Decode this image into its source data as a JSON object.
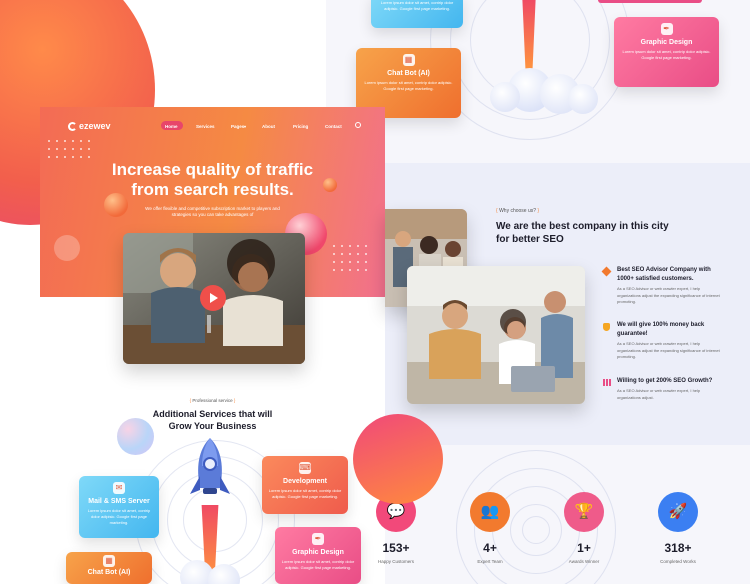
{
  "brand": {
    "logo": "ezewev"
  },
  "nav": {
    "items": [
      "Home",
      "Services",
      "Pages",
      "About",
      "Pricing",
      "Contact"
    ],
    "pages_caret": "▾",
    "search_icon": "search-icon"
  },
  "hero": {
    "title_line1": "Increase quality of traffic",
    "title_line2": "from search results.",
    "subtitle_line1": "We offer flexible and competitive subscription market to players and",
    "subtitle_line2": "strategies so you can take advantages of"
  },
  "services": {
    "eyebrow": "Professional service",
    "title_line1": "Additional Services that will",
    "title_line2": "Grow Your Business",
    "cards": {
      "mail": {
        "title": "Mail & SMS Server",
        "desc": "Lorem ipsum dolor sit amet, contrip dolor adipisic. Google first page marketing."
      },
      "development": {
        "title": "Development",
        "desc": "Lorem ipsum dolor sit amet, contrip dolor adipisic. Google first page marketing."
      },
      "graphic": {
        "title": "Graphic Design",
        "desc": "Lorem ipsum dolor sit amet, contrip dolor adipisic. Google first page marketing."
      },
      "chatbot": {
        "title": "Chat Bot (AI)",
        "desc": "Lorem ipsum dolor sit amet, contrip dolor adipisic. Google first page marketing."
      },
      "top_blue_desc": "Lorem ipsum dolor sit amet, contrip dolor adipisic. Google first page marketing."
    }
  },
  "why": {
    "eyebrow": "Why choose us?",
    "title_line1": "We are the best company in this city",
    "title_line2": "for better SEO",
    "bullets": [
      {
        "title": "Best SEO Advisor Company with 1000+ satisfied customers.",
        "desc": "As a SEO Advisor or web crawler expert, I help organizations adjust the expanding significance of internet promoting."
      },
      {
        "title": "We will give 100% money back guarantee!",
        "desc": "As a SEO Advisor or web crawler expert, I help organizations adjust the expanding significance of internet promoting."
      },
      {
        "title": "Willing to get 200% SEO Growth?",
        "desc": "As a SEO Advisor or web crawler expert, I help organizations adjust."
      }
    ]
  },
  "stats": [
    {
      "value": "153+",
      "label": "Happy Customers",
      "color": "#f2497a"
    },
    {
      "value": "4+",
      "label": "Expert Team",
      "color": "#f27a2e"
    },
    {
      "value": "1+",
      "label": "Awards Winner",
      "color": "#ef5b8a"
    },
    {
      "value": "318+",
      "label": "Completed Works",
      "color": "#3b7ff2"
    }
  ],
  "colors": {
    "accent_orange": "#f58a43",
    "accent_pink": "#f2708e",
    "accent_blue": "#3b7ff2"
  }
}
